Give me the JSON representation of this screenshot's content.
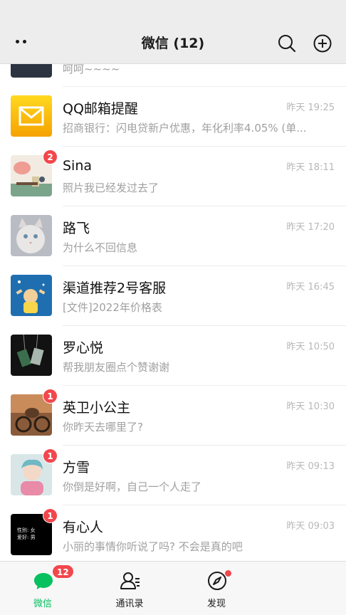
{
  "header": {
    "title": "微信 (12)",
    "more_icon": "more-dots-icon",
    "search_icon": "search-icon",
    "add_icon": "plus-circle-icon"
  },
  "partial_chat": {
    "preview": "呵呵~~~~"
  },
  "chats": [
    {
      "name": "QQ邮箱提醒",
      "preview": "招商银行：闪电贷新户优惠，年化利率4.05% (单...",
      "time": "昨天 19:25",
      "badge": "",
      "avatar": "mail-envelope-icon"
    },
    {
      "name": "Sina",
      "preview": "照片我已经发过去了",
      "time": "昨天 18:11",
      "badge": "2",
      "avatar": "avatar-illustration"
    },
    {
      "name": "路飞",
      "preview": "为什么不回信息",
      "time": "昨天 17:20",
      "badge": "",
      "avatar": "avatar-cat"
    },
    {
      "name": "渠道推荐2号客服",
      "preview": "[文件]2022年价格表",
      "time": "昨天 16:45",
      "badge": "",
      "avatar": "avatar-cartoon-sky"
    },
    {
      "name": "罗心悦",
      "preview": "帮我朋友圈点个赞谢谢",
      "time": "昨天 10:50",
      "badge": "",
      "avatar": "avatar-dark-pendant"
    },
    {
      "name": "英卫小公主",
      "preview": "你昨天去哪里了?",
      "time": "昨天 10:30",
      "badge": "1",
      "avatar": "avatar-bike"
    },
    {
      "name": "方雪",
      "preview": "你倒是好啊，自己一个人走了",
      "time": "昨天 09:13",
      "badge": "1",
      "avatar": "avatar-child"
    },
    {
      "name": "有心人",
      "preview": "小丽的事情你听说了吗? 不会是真的吧",
      "time": "昨天 09:03",
      "badge": "1",
      "avatar": "avatar-black-text",
      "avatar_text": "性别: 女\n爱好: 男"
    }
  ],
  "tabs": [
    {
      "label": "微信",
      "icon": "chat-bubble-icon",
      "badge": "12",
      "active": true
    },
    {
      "label": "通讯录",
      "icon": "contacts-icon",
      "badge": "",
      "active": false
    },
    {
      "label": "发现",
      "icon": "compass-icon",
      "badge": "",
      "dot": true,
      "active": false
    }
  ],
  "colors": {
    "accent": "#07c160",
    "badge": "#f2474c",
    "header_bg": "#ededed"
  }
}
